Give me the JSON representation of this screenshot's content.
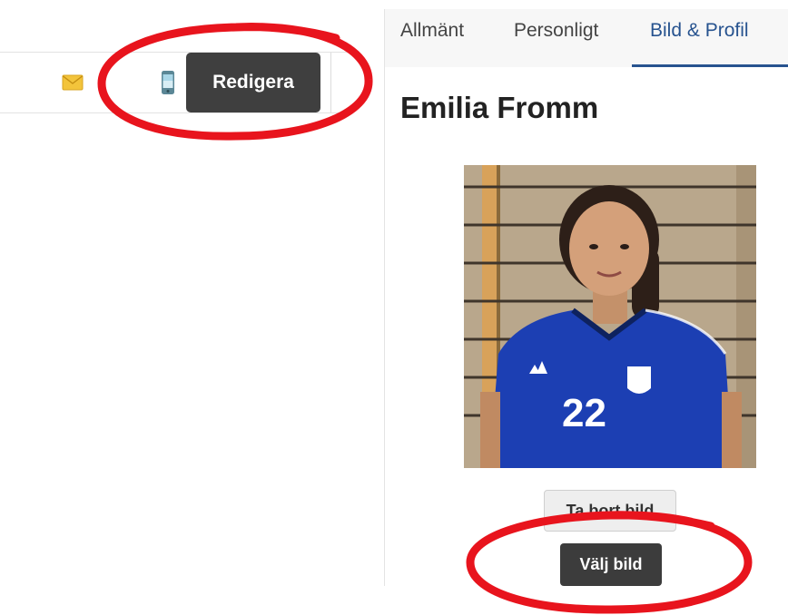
{
  "toolbar": {
    "icons": [
      "envelope-icon",
      "phone-icon"
    ],
    "edit_label": "Redigera"
  },
  "tabs": [
    {
      "label": "Allmänt",
      "active": false
    },
    {
      "label": "Personligt",
      "active": false
    },
    {
      "label": "Bild & Profil",
      "active": true
    }
  ],
  "profile": {
    "name": "Emilia Fromm",
    "jersey_number": "22",
    "remove_image_label": "Ta bort bild",
    "choose_image_label": "Välj bild"
  },
  "colors": {
    "accent": "#27538f",
    "dark_button": "#3f3f3f",
    "annotation": "#e8141d",
    "jersey": "#1c3fb3"
  }
}
